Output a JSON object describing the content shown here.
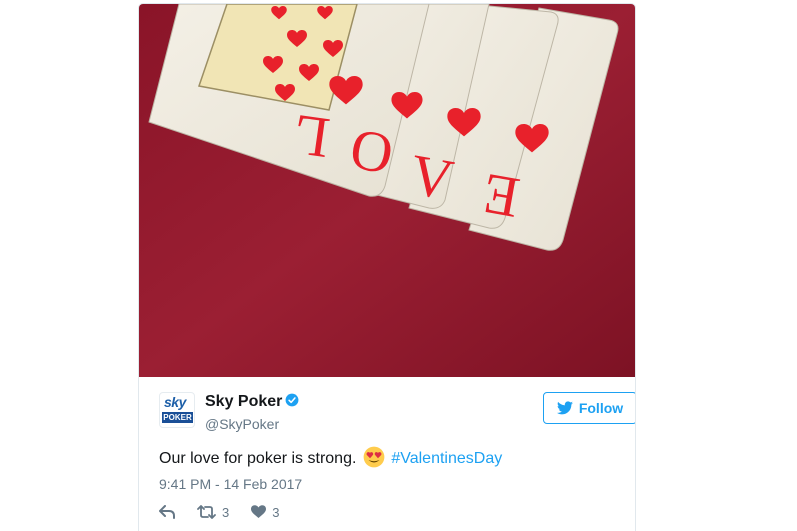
{
  "tweet": {
    "media": {
      "subject": "playing-cards-image",
      "card_letters": [
        "L",
        "O",
        "V",
        "E"
      ]
    },
    "author": {
      "avatar_top_text": "sky",
      "avatar_bottom_text": "POKER",
      "display_name": "Sky Poker",
      "handle": "@SkyPoker",
      "verified": true
    },
    "follow_label": "Follow",
    "text_before": "Our love for poker is strong.",
    "emoji": "smiling-face-with-heart-eyes",
    "hashtag": "#ValentinesDay",
    "timestamp": "9:41 PM - 14 Feb 2017",
    "actions": {
      "reply_icon": "reply-icon",
      "retweet_icon": "retweet-icon",
      "retweet_count": "3",
      "like_icon": "heart-icon",
      "like_count": "3"
    }
  },
  "colors": {
    "link": "#1da1f2",
    "text": "#14171a",
    "muted": "#657786",
    "felt": "#8e1a2c",
    "card_red": "#e8212b"
  }
}
